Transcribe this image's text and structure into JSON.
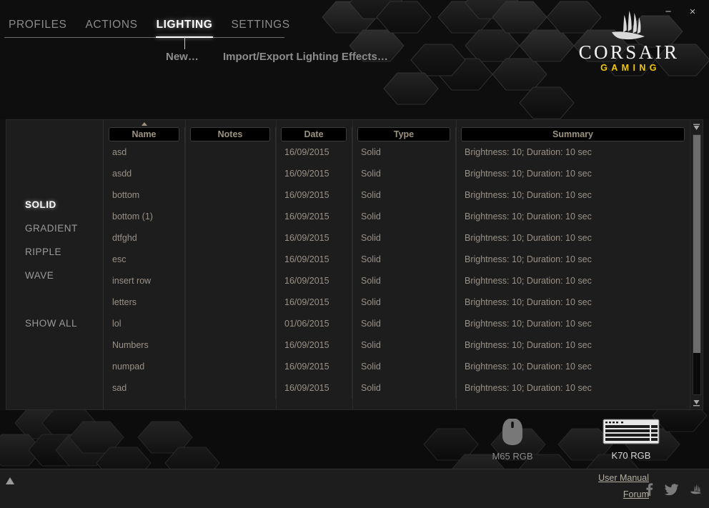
{
  "window": {
    "minimize_label": "−",
    "close_label": "×",
    "minimize_icon": "minimize-icon",
    "close_icon": "close-icon"
  },
  "brand": {
    "name": "CORSAIR",
    "sub": "GAMING",
    "sub_color": "#f0c808",
    "logo_icon": "corsair-sails-icon"
  },
  "tabs": [
    {
      "label": "PROFILES",
      "active": false
    },
    {
      "label": "ACTIONS",
      "active": false
    },
    {
      "label": "LIGHTING",
      "active": true
    },
    {
      "label": "SETTINGS",
      "active": false
    }
  ],
  "subactions": [
    {
      "label": "New…"
    },
    {
      "label": "Import/Export Lighting Effects…"
    }
  ],
  "sidebar": {
    "items": [
      {
        "label": "SOLID",
        "active": true,
        "spaced": false
      },
      {
        "label": "GRADIENT",
        "active": false,
        "spaced": false
      },
      {
        "label": "RIPPLE",
        "active": false,
        "spaced": false
      },
      {
        "label": "WAVE",
        "active": false,
        "spaced": false
      },
      {
        "label": "SHOW ALL",
        "active": false,
        "spaced": true
      }
    ]
  },
  "table": {
    "columns": [
      {
        "label": "Name",
        "key": "name",
        "cls": "col-name",
        "sorted": true
      },
      {
        "label": "Notes",
        "key": "notes",
        "cls": "col-notes",
        "sorted": false
      },
      {
        "label": "Date",
        "key": "date",
        "cls": "col-date",
        "sorted": false
      },
      {
        "label": "Type",
        "key": "type",
        "cls": "col-type",
        "sorted": false
      },
      {
        "label": "Summary",
        "key": "summary",
        "cls": "col-summary",
        "sorted": false
      }
    ],
    "rows": [
      {
        "name": "asd",
        "notes": "",
        "date": "16/09/2015",
        "type": "Solid",
        "summary": "Brightness: 10; Duration: 10 sec"
      },
      {
        "name": "asdd",
        "notes": "",
        "date": "16/09/2015",
        "type": "Solid",
        "summary": "Brightness: 10; Duration: 10 sec"
      },
      {
        "name": "bottom",
        "notes": "",
        "date": "16/09/2015",
        "type": "Solid",
        "summary": "Brightness: 10; Duration: 10 sec"
      },
      {
        "name": "bottom (1)",
        "notes": "",
        "date": "16/09/2015",
        "type": "Solid",
        "summary": "Brightness: 10; Duration: 10 sec"
      },
      {
        "name": "dtfghd",
        "notes": "",
        "date": "16/09/2015",
        "type": "Solid",
        "summary": "Brightness: 10; Duration: 10 sec"
      },
      {
        "name": "esc",
        "notes": "",
        "date": "16/09/2015",
        "type": "Solid",
        "summary": "Brightness: 10; Duration: 10 sec"
      },
      {
        "name": "insert row",
        "notes": "",
        "date": "16/09/2015",
        "type": "Solid",
        "summary": "Brightness: 10; Duration: 10 sec"
      },
      {
        "name": "letters",
        "notes": "",
        "date": "16/09/2015",
        "type": "Solid",
        "summary": "Brightness: 10; Duration: 10 sec"
      },
      {
        "name": "lol",
        "notes": "",
        "date": "01/06/2015",
        "type": "Solid",
        "summary": "Brightness: 10; Duration: 10 sec"
      },
      {
        "name": "Numbers",
        "notes": "",
        "date": "16/09/2015",
        "type": "Solid",
        "summary": "Brightness: 10; Duration: 10 sec"
      },
      {
        "name": "numpad",
        "notes": "",
        "date": "16/09/2015",
        "type": "Solid",
        "summary": "Brightness: 10; Duration: 10 sec"
      },
      {
        "name": "sad",
        "notes": "",
        "date": "16/09/2015",
        "type": "Solid",
        "summary": "Brightness: 10; Duration: 10 sec"
      }
    ]
  },
  "scrollbar": {
    "up_icon": "scroll-up-icon",
    "down_icon": "scroll-down-icon",
    "thumb_percent": 84
  },
  "devices": [
    {
      "label": "M65 RGB",
      "icon": "mouse-icon",
      "active": false
    },
    {
      "label": "K70 RGB",
      "icon": "keyboard-icon",
      "active": true
    }
  ],
  "footer": {
    "expander_icon": "expand-up-icon",
    "links": [
      {
        "label": "User Manual"
      },
      {
        "label": "Forum"
      }
    ],
    "socials": [
      {
        "icon": "facebook-icon"
      },
      {
        "icon": "twitter-icon"
      },
      {
        "icon": "corsair-sails-icon"
      }
    ]
  }
}
